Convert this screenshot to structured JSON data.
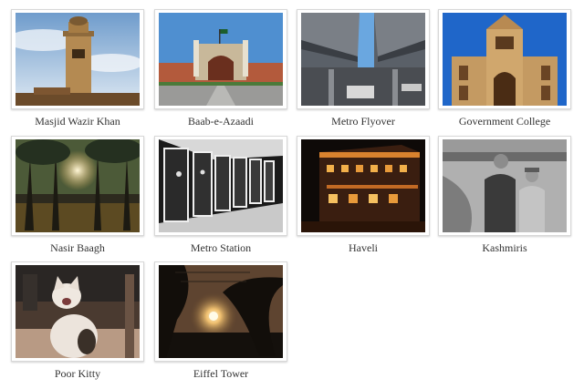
{
  "gallery": {
    "items": [
      {
        "caption": "Masjid Wazir Khan"
      },
      {
        "caption": "Baab-e-Azaadi"
      },
      {
        "caption": "Metro Flyover"
      },
      {
        "caption": "Government College"
      },
      {
        "caption": "Nasir Baagh"
      },
      {
        "caption": "Metro Station"
      },
      {
        "caption": "Haveli"
      },
      {
        "caption": "Kashmiris"
      },
      {
        "caption": "Poor Kitty"
      },
      {
        "caption": "Eiffel Tower"
      }
    ]
  }
}
